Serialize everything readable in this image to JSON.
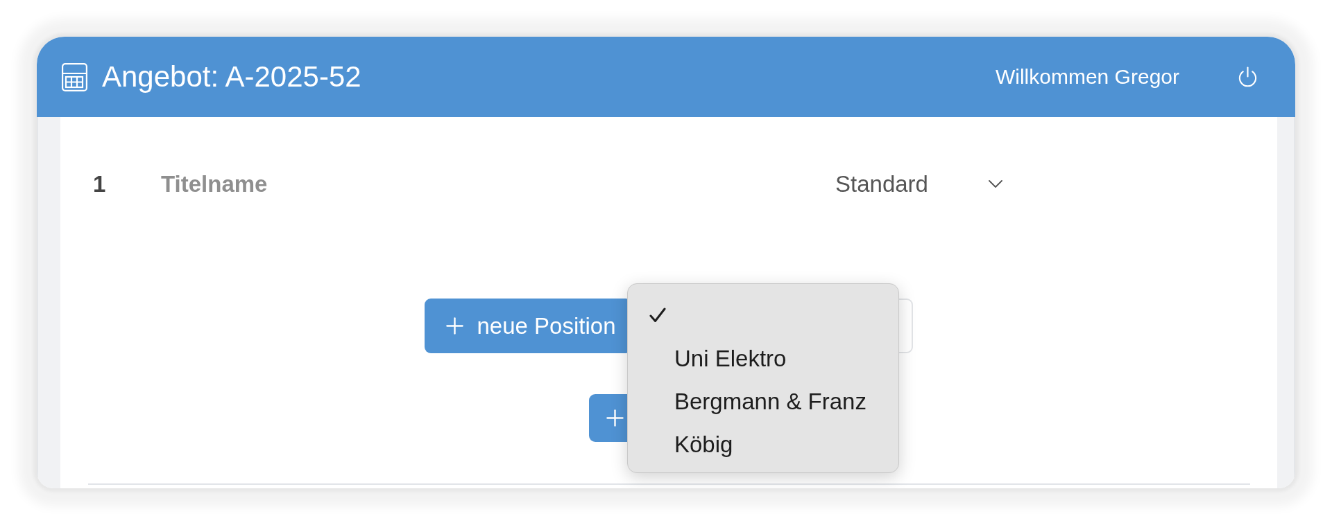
{
  "header": {
    "title": "Angebot: A-2025-52",
    "welcome": "Willkommen Gregor"
  },
  "rows": [
    {
      "number": "1",
      "title": "Titelname",
      "type": "Standard"
    }
  ],
  "action_rows": [
    {
      "buttons": [
        {
          "kind": "primary",
          "label": "neue Position"
        },
        {
          "kind": "outline"
        }
      ]
    },
    {
      "buttons": [
        {
          "kind": "primary"
        }
      ]
    }
  ],
  "dropdown": {
    "options": [
      {
        "selected": true
      },
      {
        "label": "Uni Elektro",
        "selected": false
      },
      {
        "label": "Bergmann & Franz",
        "selected": false
      },
      {
        "label": "Köbig",
        "selected": false
      }
    ]
  }
}
